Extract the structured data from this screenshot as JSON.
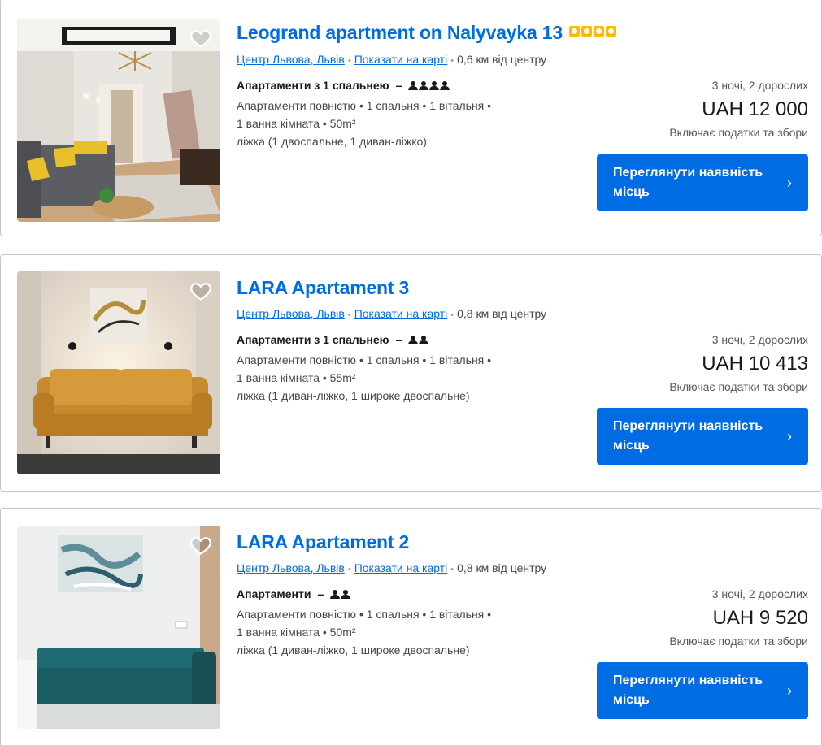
{
  "listings": [
    {
      "title": "Leogrand apartment on Nalyvayka 13",
      "stars": 4,
      "location_link": "Центр Львова, Львів",
      "map_link": "Показати на карті",
      "distance": "0,6 км від центру",
      "room_type": "Апартаменти з 1 спальнею",
      "dash": "–",
      "guests": 4,
      "desc_line1": "Апартаменти повністю • 1 спальня • 1 вітальня •",
      "desc_line2": "1 ванна кімната • 50m²",
      "desc_line3": "ліжка (1 двоспальне, 1 диван-ліжко)",
      "nights": "3 ночі, 2 дорослих",
      "price": "UAH 12 000",
      "taxes": "Включає податки та збори",
      "cta": "Переглянути наявність місць",
      "chevron": "›"
    },
    {
      "title": "LARA Apartament 3",
      "stars": 0,
      "location_link": "Центр Львова, Львів",
      "map_link": "Показати на карті",
      "distance": "0,8 км від центру",
      "room_type": "Апартаменти з 1 спальнею",
      "dash": "–",
      "guests": 2,
      "desc_line1": "Апартаменти повністю • 1 спальня • 1 вітальня •",
      "desc_line2": "1 ванна кімната • 55m²",
      "desc_line3": "ліжка (1 диван-ліжко, 1 широке двоспальне)",
      "nights": "3 ночі, 2 дорослих",
      "price": "UAH 10 413",
      "taxes": "Включає податки та збори",
      "cta": "Переглянути наявність місць",
      "chevron": "›"
    },
    {
      "title": "LARA Apartament 2",
      "stars": 0,
      "location_link": "Центр Львова, Львів",
      "map_link": "Показати на карті",
      "distance": "0,8 км від центру",
      "room_type": "Апартаменти",
      "dash": "–",
      "guests": 2,
      "desc_line1": "Апартаменти повністю • 1 спальня • 1 вітальня •",
      "desc_line2": "1 ванна кімната • 50m²",
      "desc_line3": "ліжка (1 диван-ліжко, 1 широке двоспальне)",
      "nights": "3 ночі, 2 дорослих",
      "price": "UAH 9 520",
      "taxes": "Включає податки та збори",
      "cta": "Переглянути наявність місць",
      "chevron": "›"
    }
  ],
  "separator_dot": "•",
  "colors": {
    "link": "#006ce4",
    "button": "#006ce4",
    "star": "#febb02",
    "border": "#c6c6c6"
  },
  "icons": {
    "favorite": "heart-icon",
    "rating": "star-square-icon",
    "guest": "person-icon",
    "chevron": "chevron-right-icon"
  }
}
